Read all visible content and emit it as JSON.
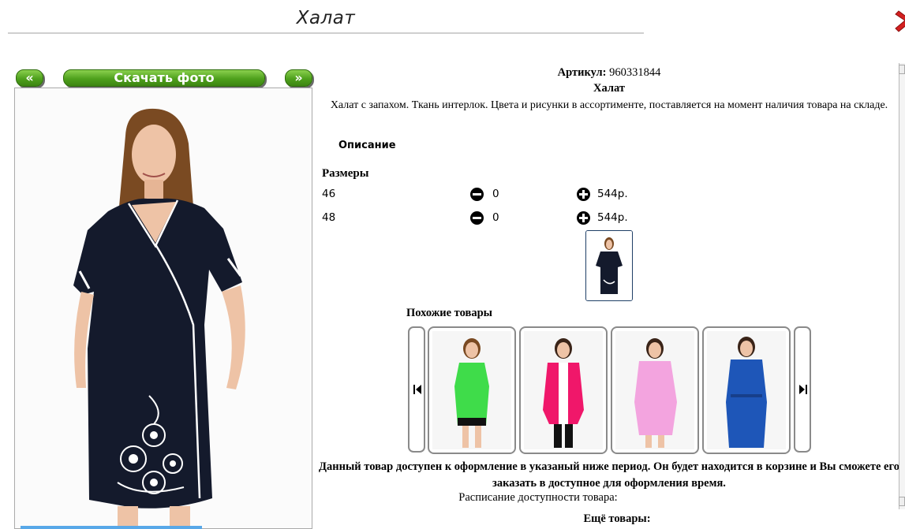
{
  "page": {
    "title": "Халат"
  },
  "gallery": {
    "prev_label": "«",
    "download_label": "Скачать фото",
    "next_label": "»"
  },
  "product": {
    "sku_label": "Артикул:",
    "sku_value": "960331844",
    "name": "Халат",
    "description": "Халат с запахом. Ткань интерлок. Цвета и рисунки в ассортименте, поставляется на момент наличия товара на складе.",
    "description_tab": "Описание",
    "sizes_label": "Размеры",
    "sizes": [
      {
        "size": "46",
        "qty": "0",
        "price": "544р."
      },
      {
        "size": "48",
        "qty": "0",
        "price": "544р."
      }
    ]
  },
  "similar": {
    "label": "Похожие товары",
    "items": [
      {
        "color": "#3fdc4a",
        "name": "green-dress"
      },
      {
        "color": "#f0176a",
        "name": "pink-robe"
      },
      {
        "color": "#f3a4df",
        "name": "light-pink-robe"
      },
      {
        "color": "#1e56b8",
        "name": "blue-robe"
      }
    ]
  },
  "availability": {
    "note": "Данный товар доступен к оформление в указаный ниже период. Он будет находится в корзине и Вы сможете его заказать в доступное для оформления время.",
    "schedule_label": "Расписание доступности товара:",
    "more_label": "Ещё товары:"
  },
  "colors": {
    "accent_green": "#4ea01c",
    "close_red": "#d42020",
    "robe_navy": "#141a2c"
  }
}
